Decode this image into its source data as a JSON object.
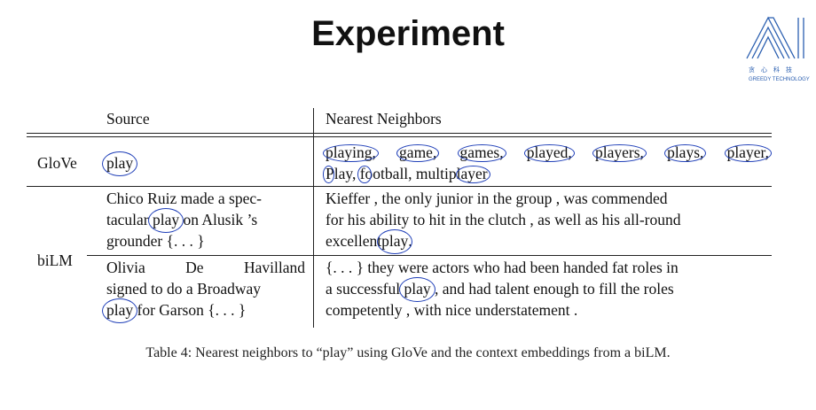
{
  "title": "Experiment",
  "logo": {
    "letters": "AI",
    "chinese": "贪心科技",
    "english": "GREEDY TECHNOLOGY"
  },
  "table": {
    "header_source": "Source",
    "header_neighbors": "Nearest Neighbors",
    "glove_label": "GloVe",
    "bilm_label": "biLM",
    "glove_source": "play",
    "glove_neighbors_line1": [
      "playing,",
      "game,",
      "games,",
      "played,",
      "players,",
      "plays,",
      "player,"
    ],
    "glove_neighbors_line2": [
      "Play,",
      "football,",
      "multiplayer"
    ],
    "bilm_rows": [
      {
        "source_lines": [
          "Chico Ruiz made a spec-",
          "tacular",
          "play",
          "on Alusik ’s",
          "grounder {. . . }"
        ],
        "neighbor_lines": [
          "Kieffer , the only junior in the group , was commended",
          "for his ability to hit in the clutch , as well as his all-round",
          "excellent",
          "play",
          "."
        ]
      },
      {
        "source_lines": [
          "Olivia",
          "De",
          "Havilland",
          "signed to do a Broadway",
          "play",
          "for Garson {. . . }"
        ],
        "neighbor_lines": [
          "{. . . } they were actors who had been handed fat roles in",
          "a successful",
          "play",
          ", and had talent enough to fill the roles",
          "competently , with nice understatement ."
        ]
      }
    ]
  },
  "caption": "Table 4: Nearest neighbors to “play” using GloVe and the context embeddings from a biLM.",
  "colors": {
    "ink": "#1f3fb8",
    "logo": "#2b5fb0"
  }
}
